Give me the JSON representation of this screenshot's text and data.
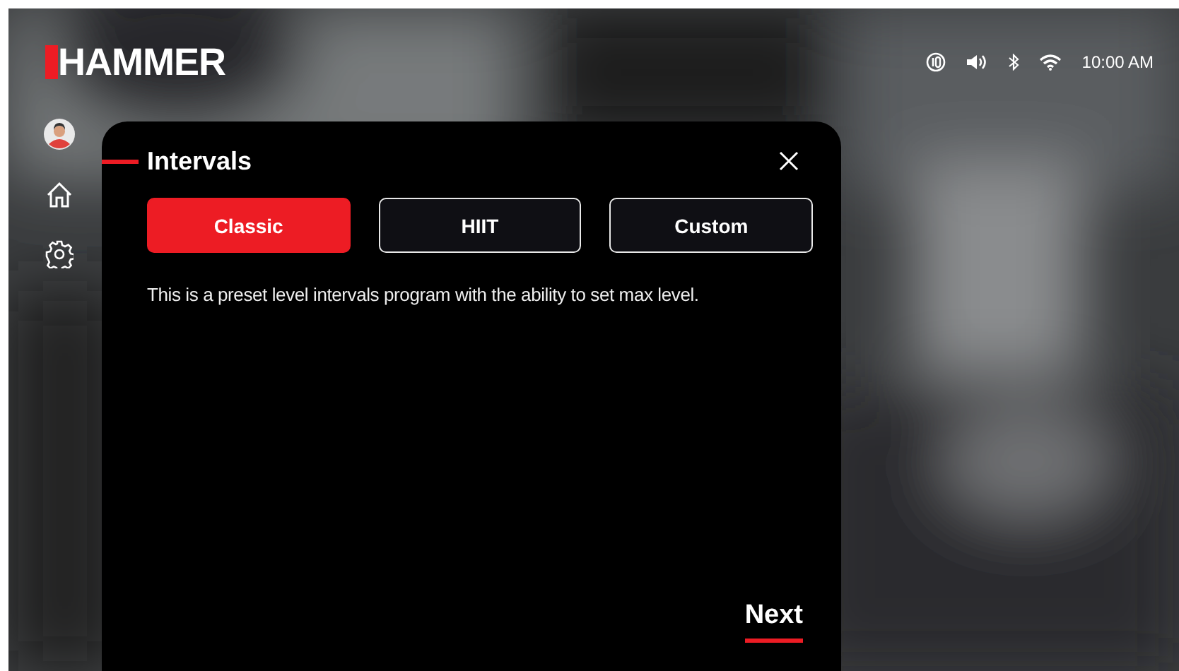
{
  "logo": {
    "text": "HAMMER"
  },
  "status_bar": {
    "time": "10:00 AM"
  },
  "dialog": {
    "title": "Intervals",
    "tabs": [
      {
        "label": "Classic",
        "selected": true
      },
      {
        "label": "HIIT",
        "selected": false
      },
      {
        "label": "Custom",
        "selected": false
      }
    ],
    "description": "This is a preset level intervals program with the ability to set max level.",
    "next_button": "Next"
  }
}
